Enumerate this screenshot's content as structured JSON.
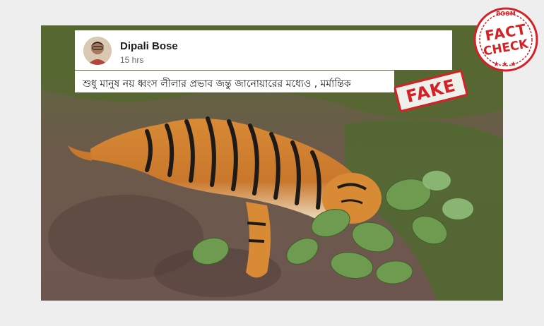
{
  "post": {
    "author": "Dipali Bose",
    "timestamp": "15 hrs",
    "caption": "শুধু মানুষ নয় ধ্বংস লীলার প্রভাব জন্তু জানোয়ারের মধ্যেও , মর্মান্তিক"
  },
  "stamp": {
    "label": "FAKE",
    "color": "#d52126"
  },
  "badge": {
    "brand": "BOOM",
    "line1": "FACT",
    "line2": "CHECK",
    "stars": "★★★",
    "color": "#d52126"
  },
  "photo": {
    "subject": "tiger lying on forest floor among leaves"
  }
}
